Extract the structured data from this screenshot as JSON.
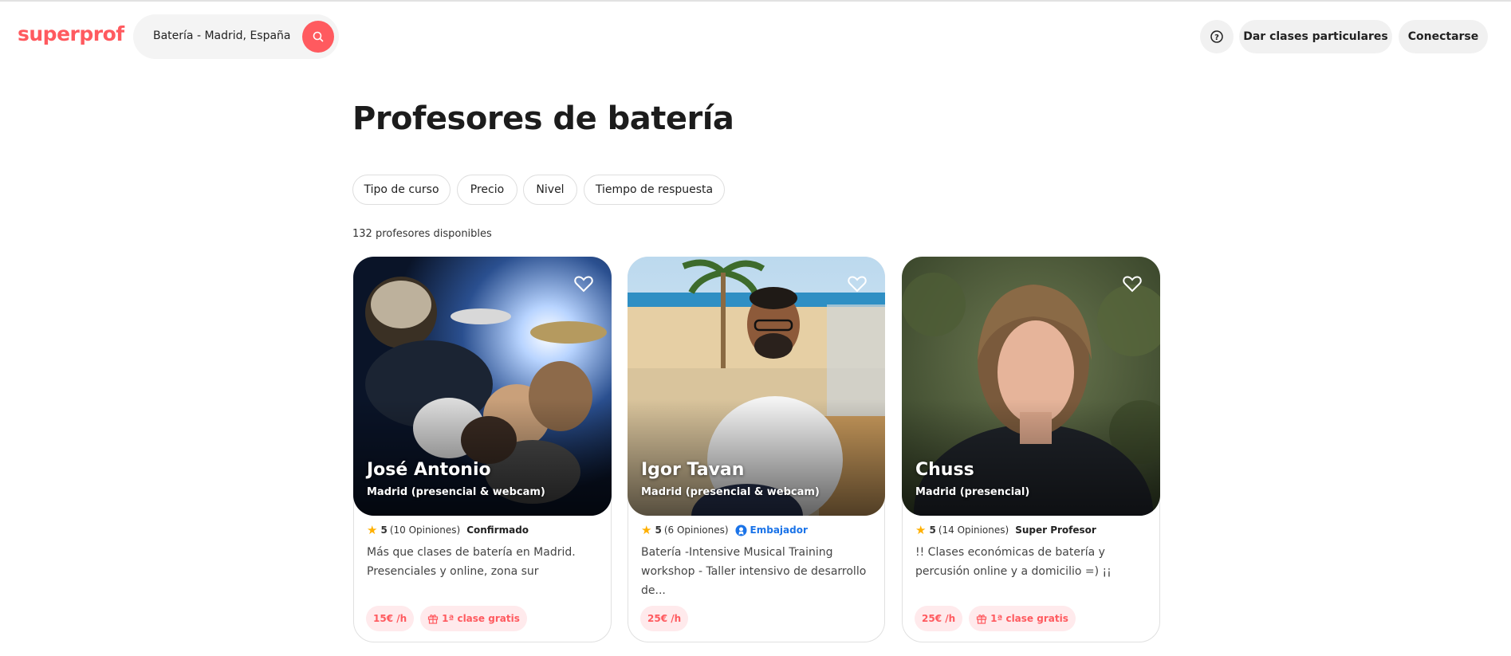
{
  "header": {
    "logo": "superprof",
    "search_value": "Batería - Madrid, España",
    "help_label": "?",
    "give_classes_label": "Dar clases particulares",
    "login_label": "Conectarse"
  },
  "main": {
    "title": "Profesores de batería",
    "filters": [
      "Tipo de curso",
      "Precio",
      "Nivel",
      "Tiempo de respuesta"
    ],
    "count_text": "132 profesores disponibles"
  },
  "cards": [
    {
      "name": "José Antonio",
      "location": "Madrid (presencial & webcam)",
      "score": "5",
      "reviews": "(10 Opiniones)",
      "badge": "Confirmado",
      "description": "Más que clases de batería en Madrid. Presenciales y online, zona sur",
      "price": "15€ /h",
      "offer": "1ª clase gratis"
    },
    {
      "name": "Igor Tavan",
      "location": "Madrid (presencial & webcam)",
      "score": "5",
      "reviews": "(6 Opiniones)",
      "badge": "Embajador",
      "description": "Batería -Intensive Musical Training workshop - Taller intensivo de desarrollo de...",
      "price": "25€ /h",
      "offer": ""
    },
    {
      "name": "Chuss",
      "location": "Madrid (presencial)",
      "score": "5",
      "reviews": "(14 Opiniones)",
      "badge": "Super Profesor",
      "description": "!! Clases económicas de batería y percusión online y a domicilio =) ¡¡",
      "price": "25€ /h",
      "offer": "1ª clase gratis"
    }
  ],
  "colors": {
    "brand": "#ff5a5f",
    "chip_bg": "#ffeaec",
    "ambassador": "#1a73e8",
    "star": "#ffb000"
  },
  "icons": [
    "search-icon",
    "help-icon",
    "heart-icon",
    "star-icon",
    "ambassador-icon",
    "gift-icon"
  ]
}
